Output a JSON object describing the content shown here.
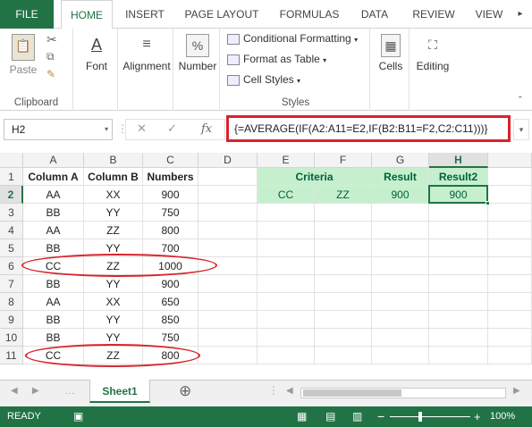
{
  "ribbon_tabs": [
    "FILE",
    "HOME",
    "INSERT",
    "PAGE LAYOUT",
    "FORMULAS",
    "DATA",
    "REVIEW",
    "VIEW"
  ],
  "ribbon": {
    "paste": "Paste",
    "clipboard": "Clipboard",
    "font": "Font",
    "alignment": "Alignment",
    "number": "Number",
    "conditional_formatting": "Conditional Formatting",
    "format_as_table": "Format as Table",
    "cell_styles": "Cell Styles",
    "styles": "Styles",
    "cells": "Cells",
    "editing": "Editing",
    "number_icon": "%",
    "font_icon": "A"
  },
  "formula_bar": {
    "name_box": "H2",
    "formula": "{=AVERAGE(IF(A2:A11=E2,IF(B2:B11=F2,C2:C11)))}",
    "cancel_icon": "✕",
    "enter_icon": "✓",
    "fx": "fx"
  },
  "columns": [
    "A",
    "B",
    "C",
    "D",
    "E",
    "F",
    "G",
    "H"
  ],
  "rows": [
    "1",
    "2",
    "3",
    "4",
    "5",
    "6",
    "7",
    "8",
    "9",
    "10",
    "11"
  ],
  "table": {
    "headers": [
      "Column A",
      "Column B",
      "Numbers"
    ],
    "data": [
      [
        "AA",
        "XX",
        "900"
      ],
      [
        "BB",
        "YY",
        "750"
      ],
      [
        "AA",
        "ZZ",
        "800"
      ],
      [
        "BB",
        "YY",
        "700"
      ],
      [
        "CC",
        "ZZ",
        "1000"
      ],
      [
        "BB",
        "YY",
        "900"
      ],
      [
        "AA",
        "XX",
        "650"
      ],
      [
        "BB",
        "YY",
        "850"
      ],
      [
        "BB",
        "YY",
        "750"
      ],
      [
        "CC",
        "ZZ",
        "800"
      ]
    ]
  },
  "criteria": {
    "header": "Criteria",
    "e2": "CC",
    "f2": "ZZ",
    "result_header": "Result",
    "g2": "900",
    "result2_header": "Result2",
    "h2": "900"
  },
  "sheet_tab": "Sheet1",
  "add_sheet_icon": "⊕",
  "status": {
    "ready": "READY",
    "zoom": "100%",
    "minus": "−",
    "plus": "+"
  },
  "colors": {
    "excel_green": "#217346",
    "highlight_green": "#c6efce",
    "annotation_red": "#d9232a"
  }
}
